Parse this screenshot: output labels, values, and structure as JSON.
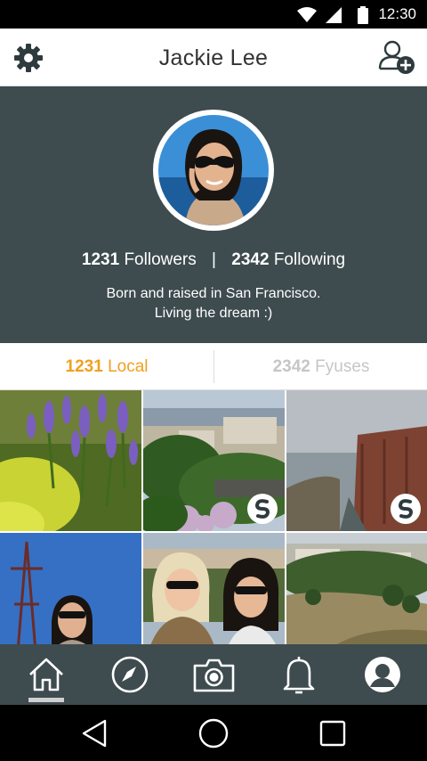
{
  "status_bar": {
    "time": "12:30"
  },
  "header": {
    "title": "Jackie Lee"
  },
  "profile": {
    "followers_count": "1231",
    "followers_label": "Followers",
    "separator": "|",
    "following_count": "2342",
    "following_label": "Following",
    "bio_line1": "Born and raised in San Francisco.",
    "bio_line2": "Living the dream :)"
  },
  "tabs": {
    "local_count": "1231",
    "local_label": "Local",
    "fyuses_count": "2342",
    "fyuses_label": "Fyuses"
  },
  "colors": {
    "accent": "#f0a020",
    "profile_bg": "#3e4b4f",
    "inactive_tab": "#c6c6c6"
  },
  "icons": {
    "header_left": "gear-icon",
    "header_right": "add-friend-icon",
    "nav": [
      "home-icon",
      "compass-icon",
      "camera-icon",
      "bell-icon",
      "profile-icon"
    ],
    "system": [
      "back-icon",
      "home-circle-icon",
      "recents-icon"
    ]
  }
}
